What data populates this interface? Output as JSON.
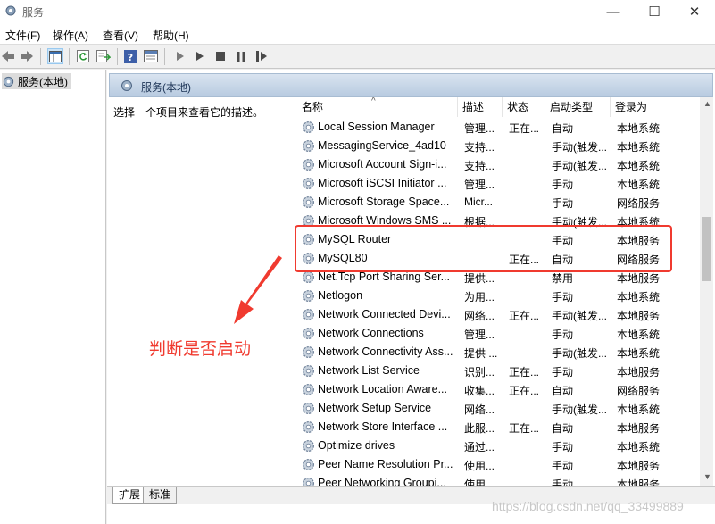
{
  "window": {
    "title": "服务"
  },
  "menu": [
    "文件(F)",
    "操作(A)",
    "查看(V)",
    "帮助(H)"
  ],
  "toolbar_icons": [
    "back-arrow-icon",
    "forward-arrow-icon",
    "show-hide-tree-icon",
    "refresh-icon",
    "export-list-icon",
    "help-icon",
    "properties-icon",
    "start-service-icon",
    "start-icon",
    "stop-icon",
    "pause-icon",
    "resume-icon"
  ],
  "tree": {
    "node_label": "服务(本地)"
  },
  "panel": {
    "header_title": "服务(本地)",
    "description": "选择一个项目来查看它的描述。"
  },
  "columns": {
    "name": "名称",
    "desc": "描述",
    "status": "状态",
    "startup": "启动类型",
    "logon": "登录为"
  },
  "services": [
    {
      "name": "Local Session Manager",
      "desc": "管理...",
      "status": "正在...",
      "startup": "自动",
      "logon": "本地系统"
    },
    {
      "name": "MessagingService_4ad10",
      "desc": "支持...",
      "status": "",
      "startup": "手动(触发...",
      "logon": "本地系统"
    },
    {
      "name": "Microsoft Account Sign-i...",
      "desc": "支持...",
      "status": "",
      "startup": "手动(触发...",
      "logon": "本地系统"
    },
    {
      "name": "Microsoft iSCSI Initiator ...",
      "desc": "管理...",
      "status": "",
      "startup": "手动",
      "logon": "本地系统"
    },
    {
      "name": "Microsoft Storage Space...",
      "desc": "Micr...",
      "status": "",
      "startup": "手动",
      "logon": "网络服务"
    },
    {
      "name": "Microsoft Windows SMS ...",
      "desc": "根据...",
      "status": "",
      "startup": "手动(触发...",
      "logon": "本地系统"
    },
    {
      "name": "MySQL Router",
      "desc": "",
      "status": "",
      "startup": "手动",
      "logon": "本地服务"
    },
    {
      "name": "MySQL80",
      "desc": "",
      "status": "正在...",
      "startup": "自动",
      "logon": "网络服务"
    },
    {
      "name": "Net.Tcp Port Sharing Ser...",
      "desc": "提供...",
      "status": "",
      "startup": "禁用",
      "logon": "本地服务"
    },
    {
      "name": "Netlogon",
      "desc": "为用...",
      "status": "",
      "startup": "手动",
      "logon": "本地系统"
    },
    {
      "name": "Network Connected Devi...",
      "desc": "网络...",
      "status": "正在...",
      "startup": "手动(触发...",
      "logon": "本地服务"
    },
    {
      "name": "Network Connections",
      "desc": "管理...",
      "status": "",
      "startup": "手动",
      "logon": "本地系统"
    },
    {
      "name": "Network Connectivity Ass...",
      "desc": "提供 ...",
      "status": "",
      "startup": "手动(触发...",
      "logon": "本地系统"
    },
    {
      "name": "Network List Service",
      "desc": "识别...",
      "status": "正在...",
      "startup": "手动",
      "logon": "本地服务"
    },
    {
      "name": "Network Location Aware...",
      "desc": "收集...",
      "status": "正在...",
      "startup": "自动",
      "logon": "网络服务"
    },
    {
      "name": "Network Setup Service",
      "desc": "网络...",
      "status": "",
      "startup": "手动(触发...",
      "logon": "本地系统"
    },
    {
      "name": "Network Store Interface ...",
      "desc": "此服...",
      "status": "正在...",
      "startup": "自动",
      "logon": "本地服务"
    },
    {
      "name": "Optimize drives",
      "desc": "通过...",
      "status": "",
      "startup": "手动",
      "logon": "本地系统"
    },
    {
      "name": "Peer Name Resolution Pr...",
      "desc": "使用...",
      "status": "",
      "startup": "手动",
      "logon": "本地服务"
    },
    {
      "name": "Peer Networking Groupi...",
      "desc": "使用...",
      "status": "",
      "startup": "手动",
      "logon": "本地服务"
    }
  ],
  "tabs": [
    "扩展",
    "标准"
  ],
  "annotation": {
    "text": "判断是否启动",
    "color": "#f03a2f"
  },
  "watermark": "https://blog.csdn.net/qq_33499889"
}
